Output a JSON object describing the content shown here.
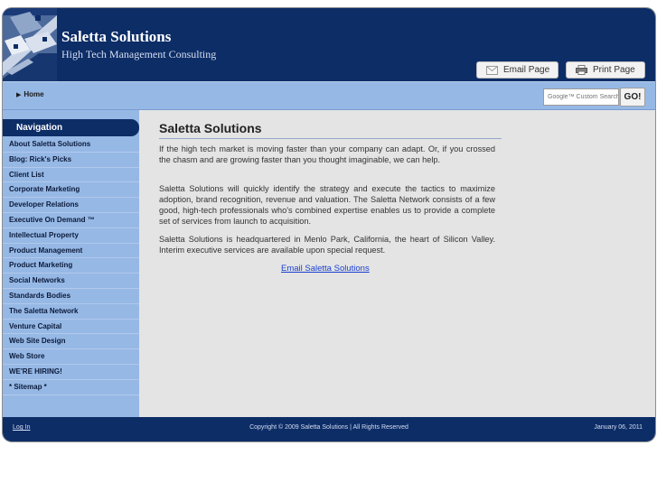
{
  "header": {
    "site_title": "Saletta Solutions",
    "tagline": "High Tech Management Consulting",
    "email_page_label": "Email Page",
    "print_page_label": "Print Page",
    "email_icon": "envelope-icon",
    "print_icon": "printer-icon"
  },
  "breadcrumb": {
    "home": "Home"
  },
  "search": {
    "placeholder": "Google™ Custom Search",
    "button_label": "GO!"
  },
  "sidebar": {
    "title": "Navigation",
    "items": [
      {
        "label": "About Saletta Solutions"
      },
      {
        "label": "Blog: Rick's Picks"
      },
      {
        "label": "Client List"
      },
      {
        "label": "Corporate Marketing"
      },
      {
        "label": "Developer Relations"
      },
      {
        "label": "Executive On Demand ™"
      },
      {
        "label": "Intellectual Property"
      },
      {
        "label": "Product Management"
      },
      {
        "label": "Product Marketing"
      },
      {
        "label": "Social Networks"
      },
      {
        "label": "Standards Bodies"
      },
      {
        "label": "The Saletta Network"
      },
      {
        "label": "Venture Capital"
      },
      {
        "label": "Web Site Design"
      },
      {
        "label": "Web Store"
      },
      {
        "label": "WE'RE HIRING!"
      },
      {
        "label": "* Sitemap *"
      }
    ]
  },
  "main": {
    "title": "Saletta Solutions",
    "paragraphs": [
      "If the high tech market is moving faster than your company can adapt. Or, if you crossed the chasm and are growing faster than you thought imaginable, we can help.",
      "Saletta Solutions will quickly identify the strategy and execute the tactics to maximize adoption, brand recognition, revenue and valuation. The Saletta Network consists of a few good, high-tech professionals who's combined expertise enables us to provide a complete set of services from launch to acquisition.",
      "Saletta Solutions is headquartered in Menlo Park, California, the heart of Silicon Valley. Interim executive services are available upon special request."
    ],
    "email_link": "Email Saletta Solutions"
  },
  "footer": {
    "login": "Log In",
    "copyright": "Copyright © 2009 Saletta Solutions | All Rights Reserved",
    "date": "January 06, 2011"
  },
  "colors": {
    "header_bg": "#0d2d67",
    "bar_bg": "#96b8e5",
    "content_bg": "#e4e4e4",
    "link": "#1a3fd1"
  }
}
